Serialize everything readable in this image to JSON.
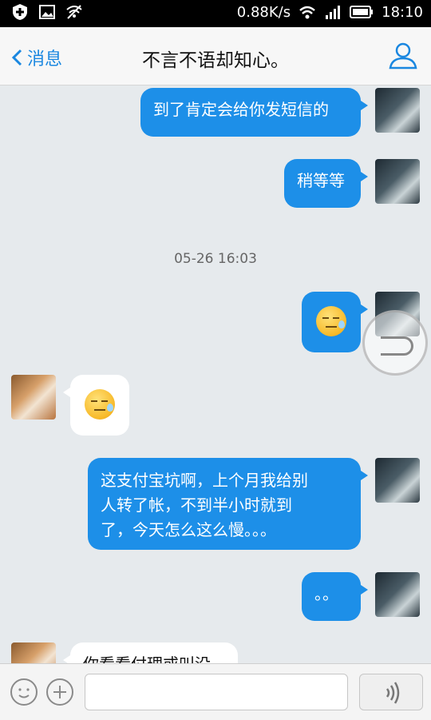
{
  "status_bar": {
    "speed": "0.88K/s",
    "time": "18:10"
  },
  "header": {
    "back_label": "消息",
    "title": "不言不语却知心。"
  },
  "messages": [
    {
      "text": "到了肯定会给你发短信的"
    },
    {
      "text": "稍等等"
    },
    {
      "timestamp": "05-26 16:03"
    },
    {
      "emoji": "sweat-face"
    },
    {
      "emoji": "sweat-face"
    },
    {
      "lines": [
        "这支付宝坑啊，上个月我给别",
        "人转了帐，不到半小时就到",
        "了，今天怎么这么慢。。。"
      ]
    },
    {
      "text": "。。"
    },
    {
      "text": "你看看付理或叫没"
    }
  ],
  "colors": {
    "bubble_out": "#1d8fe8",
    "bubble_in": "#ffffff",
    "accent": "#1a87e0"
  }
}
